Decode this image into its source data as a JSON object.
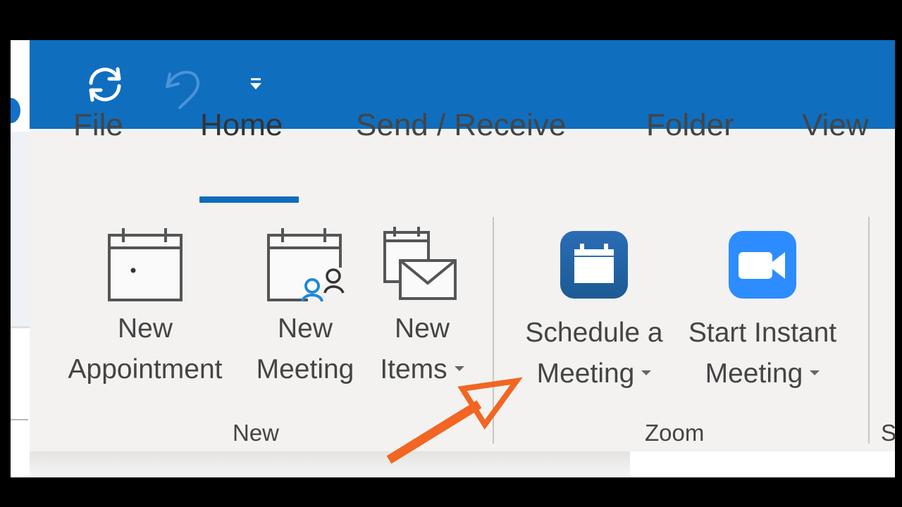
{
  "quick_access": {
    "sync_icon": "sync-icon",
    "undo_icon": "undo-icon",
    "customize_icon": "customize-quick-access-icon"
  },
  "tabs": [
    {
      "label": "File",
      "active": false
    },
    {
      "label": "Home",
      "active": true
    },
    {
      "label": "Send / Receive",
      "active": false
    },
    {
      "label": "Folder",
      "active": false
    },
    {
      "label": "View",
      "active": false
    }
  ],
  "groups": {
    "new": {
      "label": "New",
      "buttons": [
        {
          "line1": "New",
          "line2": "Appointment",
          "icon": "calendar-appointment-icon",
          "dropdown": false
        },
        {
          "line1": "New",
          "line2": "Meeting",
          "icon": "calendar-meeting-icon",
          "dropdown": false
        },
        {
          "line1": "New",
          "line2": "Items",
          "icon": "new-items-icon",
          "dropdown": true
        }
      ]
    },
    "zoom": {
      "label": "Zoom",
      "buttons": [
        {
          "line1": "Schedule a",
          "line2": "Meeting",
          "icon": "zoom-schedule-icon",
          "dropdown": true
        },
        {
          "line1": "Start Instant",
          "line2": "Meeting",
          "icon": "zoom-video-icon",
          "dropdown": true
        }
      ]
    },
    "partial": {
      "label": "S"
    }
  },
  "colors": {
    "title_bar": "#106ebe",
    "accent_underline": "#0f6cbd",
    "ribbon_bg": "#f3f2f1",
    "zoom_schedule": "#1d5fa3",
    "zoom_video": "#2d8cff",
    "annotation_arrow": "#f26522",
    "person_accent": "#1e88d8"
  },
  "annotation": {
    "type": "arrow",
    "points_to": "Schedule a Meeting"
  }
}
